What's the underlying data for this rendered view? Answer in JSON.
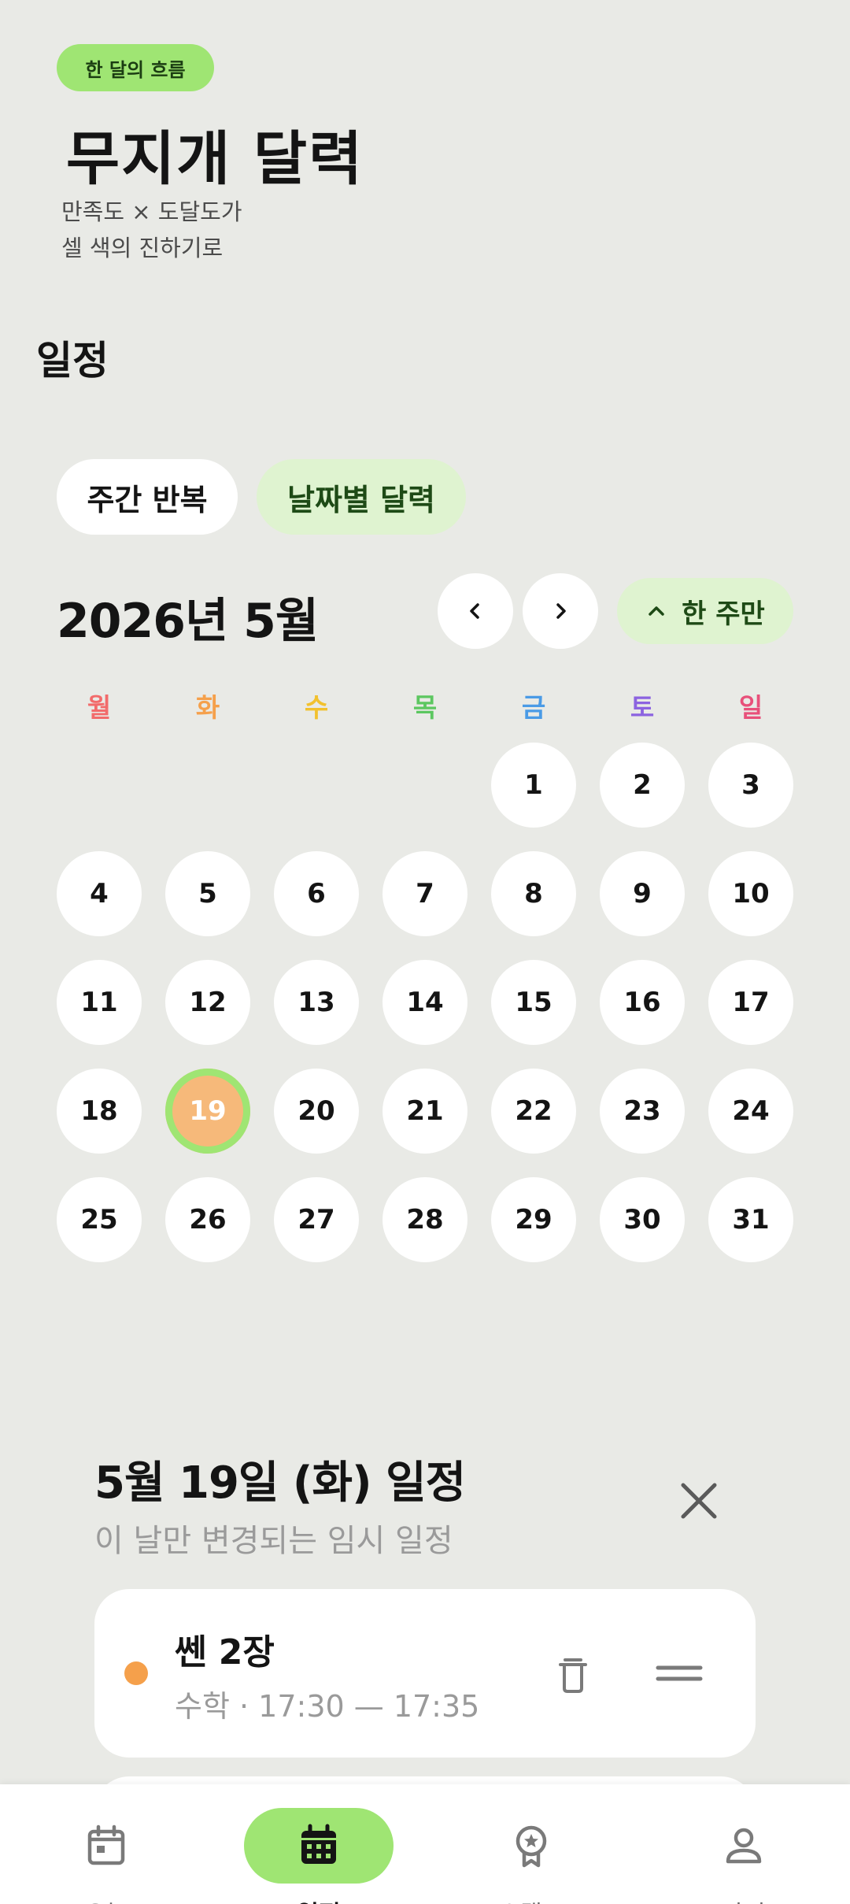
{
  "hero": {
    "tag": "한 달의 흐름",
    "title": "무지개 달력",
    "subtitle_line1": "만족도 × 도달도가",
    "subtitle_line2": "셀 색의 진하기로"
  },
  "section_title": "일정",
  "tabs": {
    "weekly": "주간 반복",
    "daily": "날짜별 달력",
    "selected": "daily"
  },
  "calendar": {
    "month_title": "2026년 5월",
    "week_toggle_label": "한 주만",
    "weekdays": [
      {
        "label": "월",
        "color": "#f26b6b"
      },
      {
        "label": "화",
        "color": "#f5a04b"
      },
      {
        "label": "수",
        "color": "#f2c12e"
      },
      {
        "label": "목",
        "color": "#5cc760"
      },
      {
        "label": "금",
        "color": "#4a9be6"
      },
      {
        "label": "토",
        "color": "#8c63e0"
      },
      {
        "label": "일",
        "color": "#e8507a"
      }
    ],
    "first_weekday_index": 4,
    "days_in_month": 31,
    "selected_day": 19,
    "selected_fill": "#f6b97a",
    "selected_ring": "#9fe573"
  },
  "detail": {
    "title": "5월 19일 (화) 일정",
    "subtitle": "이 날만 변경되는 임시 일정",
    "events": [
      {
        "name": "쎈 2장",
        "meta": "수학 · 17:30 — 17:35",
        "color": "#f5a04b"
      }
    ]
  },
  "bottom_nav": {
    "items": [
      {
        "label": "오늘",
        "icon": "calendar-today-icon"
      },
      {
        "label": "일정",
        "icon": "calendar-grid-icon",
        "active": true
      },
      {
        "label": "스탬프",
        "icon": "badge-icon"
      },
      {
        "label": "마이",
        "icon": "person-icon"
      }
    ]
  }
}
